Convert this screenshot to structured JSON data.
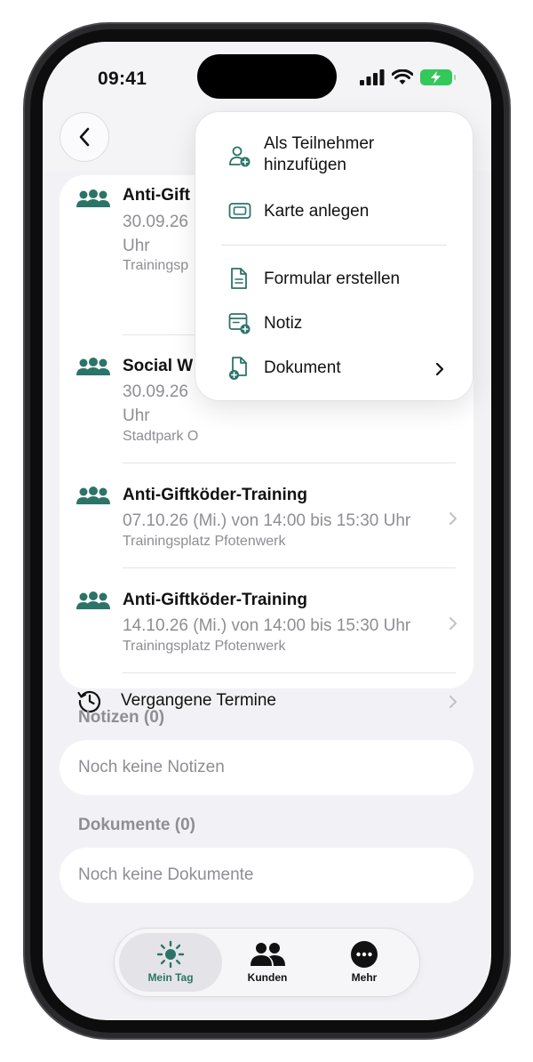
{
  "status_bar": {
    "time": "09:41"
  },
  "colors": {
    "accent": "#2c7468",
    "battery": "#34c759",
    "text_secondary": "#8e8e93"
  },
  "header": {
    "back_icon": "chevron-left-icon"
  },
  "events": [
    {
      "title": "Anti-Gift",
      "time": "30.09.26",
      "time2": "Uhr",
      "place": "Trainingsp",
      "icon": "group-icon"
    },
    {
      "title": "Social W",
      "time": "30.09.26",
      "time2": "Uhr",
      "place": "Stadtpark O",
      "icon": "group-icon"
    },
    {
      "title": "Anti-Giftköder-Training",
      "time": "07.10.26 (Mi.) von 14:00 bis 15:30 Uhr",
      "place": "Trainingsplatz Pfotenwerk",
      "icon": "group-icon"
    },
    {
      "title": "Anti-Giftköder-Training",
      "time": "14.10.26 (Mi.) von 14:00 bis 15:30 Uhr",
      "place": "Trainingsplatz Pfotenwerk",
      "icon": "group-icon"
    }
  ],
  "past_events": {
    "label": "Vergangene Termine",
    "icon": "history-icon"
  },
  "notes": {
    "title": "Notizen (0)",
    "empty": "Noch keine Notizen"
  },
  "documents": {
    "title": "Dokumente (0)",
    "empty": "Noch keine Dokumente"
  },
  "menu": {
    "items": [
      {
        "label": "Als Teilnehmer",
        "label2": "hinzufügen",
        "icon": "add-person-icon"
      },
      {
        "label": "Karte anlegen",
        "icon": "ticket-icon"
      },
      {
        "label": "Formular erstellen",
        "icon": "form-document-icon"
      },
      {
        "label": "Notiz",
        "icon": "note-add-icon"
      },
      {
        "label": "Dokument",
        "icon": "document-add-icon"
      }
    ]
  },
  "tabbar": {
    "tabs": [
      {
        "label": "Mein Tag",
        "icon": "sun-icon",
        "active": true
      },
      {
        "label": "Kunden",
        "icon": "people-icon",
        "active": false
      },
      {
        "label": "Mehr",
        "icon": "more-icon",
        "active": false
      }
    ]
  }
}
